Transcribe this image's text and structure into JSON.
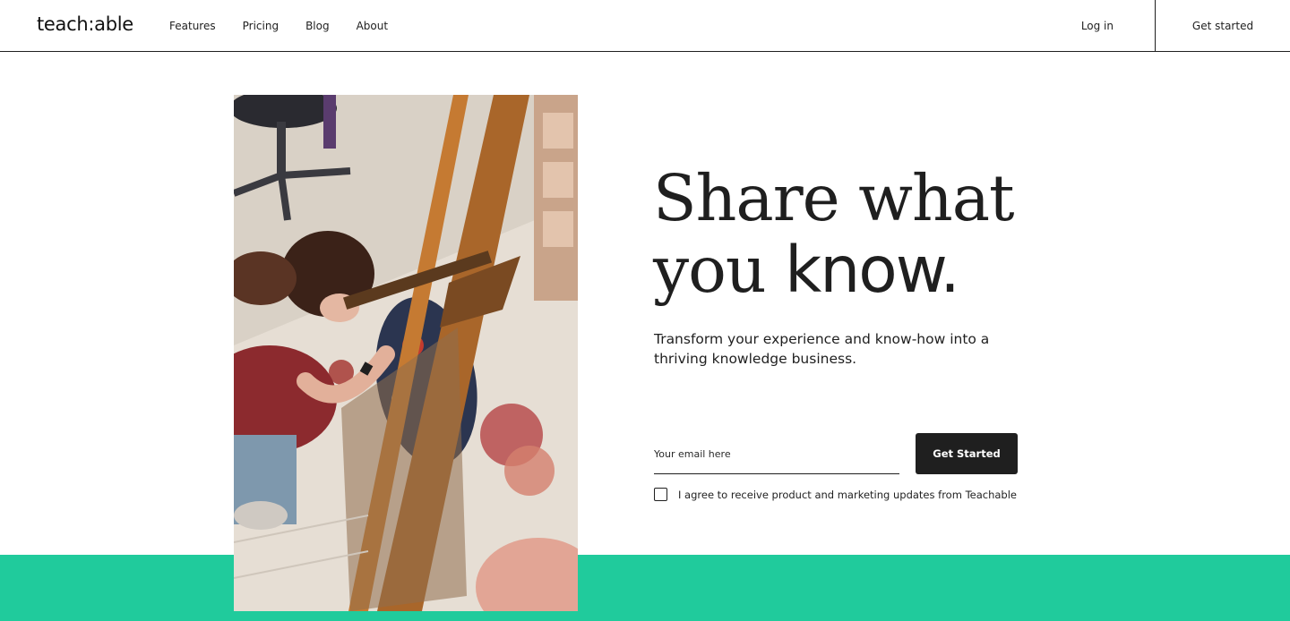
{
  "nav": {
    "logo": "teach:able",
    "links": [
      "Features",
      "Pricing",
      "Blog",
      "About"
    ],
    "login": "Log in",
    "get_started": "Get started"
  },
  "hero": {
    "headline_line1": "Share what",
    "headline_line2_serif": "you ",
    "headline_line2_bold": "know.",
    "subhead": "Transform your experience and know-how into a thriving knowledge business.",
    "email_placeholder": "Your email here",
    "email_value": "",
    "cta": "Get Started",
    "consent": "I agree to receive product and marketing updates from Teachable",
    "consent_checked": false,
    "photo_alt": "artist-painting-photo"
  },
  "colors": {
    "brand_green": "#20cb9c",
    "dark": "#1f1f1f"
  }
}
